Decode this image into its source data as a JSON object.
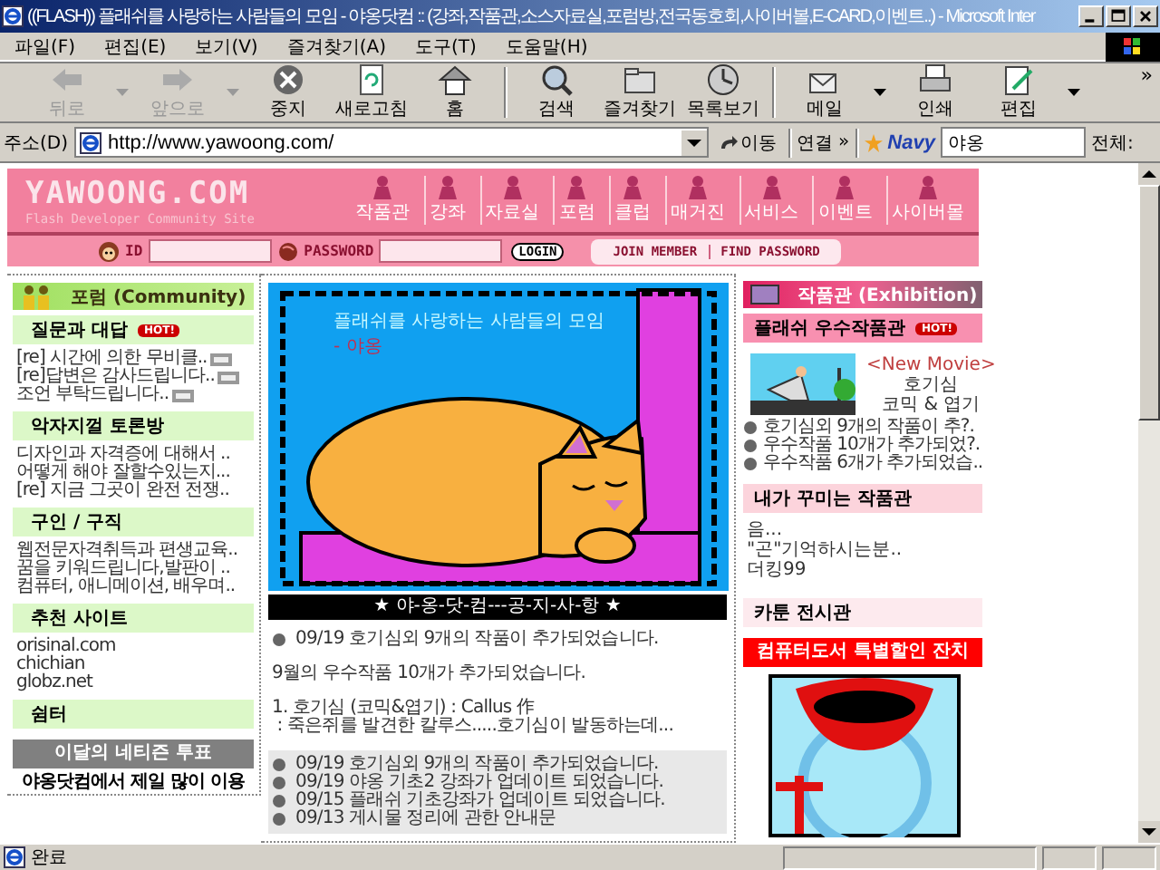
{
  "window": {
    "title": "((FLASH)) 플래쉬를 사랑하는 사람들의 모임 - 야옹닷컴 :: (강좌,작품관,소스자료실,포럼방,전국동호회,사이버볼,E-CARD,이벤트..) - Microsoft Inter"
  },
  "menu": [
    "파일(F)",
    "편집(E)",
    "보기(V)",
    "즐겨찾기(A)",
    "도구(T)",
    "도움말(H)"
  ],
  "toolbar": [
    {
      "label": "뒤로",
      "disabled": true,
      "dropdown": true
    },
    {
      "label": "앞으로",
      "disabled": true,
      "dropdown": true
    },
    {
      "label": "중지",
      "disabled": false,
      "dropdown": false
    },
    {
      "label": "새로고침",
      "disabled": false,
      "dropdown": false
    },
    {
      "label": "홈",
      "disabled": false,
      "dropdown": false
    },
    {
      "label": "검색",
      "disabled": false,
      "dropdown": false
    },
    {
      "label": "즐겨찾기",
      "disabled": false,
      "dropdown": false
    },
    {
      "label": "목록보기",
      "disabled": false,
      "dropdown": false
    },
    {
      "label": "메일",
      "disabled": false,
      "dropdown": true
    },
    {
      "label": "인쇄",
      "disabled": false,
      "dropdown": false
    },
    {
      "label": "편집",
      "disabled": false,
      "dropdown": true
    }
  ],
  "toolbar_more": "»",
  "address": {
    "label": "주소(D)",
    "value": "http://www.yawoong.com/",
    "go": "이동",
    "links": "연결",
    "links_more": "»",
    "search_logo": "Navy",
    "search_value": "야옹",
    "search_scope": "전체:"
  },
  "site": {
    "logo": "YAWOONG.COM",
    "tagline": "Flash Developer Community Site",
    "nav": [
      "작품관",
      "강좌",
      "자료실",
      "포럼",
      "클럽",
      "매거진",
      "서비스",
      "이벤트",
      "사이버몰"
    ],
    "id_label": "ID",
    "password_label": "PASSWORD",
    "login": "LOGIN",
    "member_links": [
      "JOIN MEMBER",
      "FIND PASSWORD"
    ]
  },
  "left": {
    "title": "포럼 (Community)",
    "sections": [
      {
        "title": "질문과 대답",
        "hot": "HOT!",
        "items": [
          {
            "text": "[re] 시간에 의한 무비클..",
            "new": true
          },
          {
            "text": "[re]답변은 감사드립니다..",
            "new": true
          },
          {
            "text": "조언 부탁드립니다..",
            "new": true
          }
        ]
      },
      {
        "title": "악자지껄 토론방",
        "items": [
          {
            "text": "디자인과 자격증에 대해서 ..",
            "new": false
          },
          {
            "text": "어떻게 해야 잘할수있는지...",
            "new": false
          },
          {
            "text": "[re] 지금 그곳이 완전 전쟁..",
            "new": false
          }
        ]
      },
      {
        "title": "구인 / 구직",
        "items": [
          {
            "text": "웹전문자격취득과 편생교육..",
            "new": false
          },
          {
            "text": "꿈을 키워드립니다,발판이 ..",
            "new": false
          },
          {
            "text": "컴퓨터, 애니메이션, 배우며..",
            "new": false
          }
        ]
      },
      {
        "title": "추천 사이트",
        "items": [
          {
            "text": "orisinal.com",
            "new": false
          },
          {
            "text": "chichian",
            "new": false
          },
          {
            "text": "globz.net",
            "new": false
          }
        ]
      },
      {
        "title": "쉼터"
      }
    ],
    "poll": {
      "title": "이달의 네티즌 투표",
      "text": "야옹닷컴에서 제일 많이 이용"
    }
  },
  "center": {
    "banner": {
      "headline": "플래쉬를 사랑하는 사람들의 모임",
      "sub": "- 야옹"
    },
    "notice_title": "★ 야-옹-닷-컴---공-지-사-항 ★",
    "headline": "09/19 호기심외 9개의 작품이 추가되었습니다.",
    "paragraphs": [
      "9월의 우수작품 10개가 추가되었습니다.",
      "1. 호기심 (코믹&엽기) : Callus 作\n : 죽은쥐를 발견한 칼루스.....호기심이 발동하는데..."
    ],
    "recent": [
      "09/19 호기심외 9개의 작품이 추가되었습니다.",
      "09/19 야옹 기초2 강좌가 업데이트 되었습니다.",
      "09/15 플래쉬 기초강좌가 업데이트 되었습니다.",
      "09/13 게시물 정리에 관한 안내문"
    ]
  },
  "right": {
    "title": "작품관 (Exhibition)",
    "best": {
      "title": "플래쉬 우수작품관",
      "hot": "HOT!",
      "tag": "<New Movie>",
      "movie_title": "호기심",
      "genre": "코믹 & 엽기",
      "items": [
        "호기심외 9개의 작품이 추?.",
        "우수작품 10개가 추가되었?.",
        "우수작품 6개가 추가되었습.."
      ]
    },
    "my_gallery": {
      "title": "내가 꾸미는 작품관",
      "items": [
        "음...",
        "\"곤\"기억하시는분..",
        "더킹99"
      ]
    },
    "cartoon": "카툰 전시관",
    "promo": "컴퓨터도서 특별할인 잔치"
  },
  "status_bar": {
    "text": "완료"
  }
}
